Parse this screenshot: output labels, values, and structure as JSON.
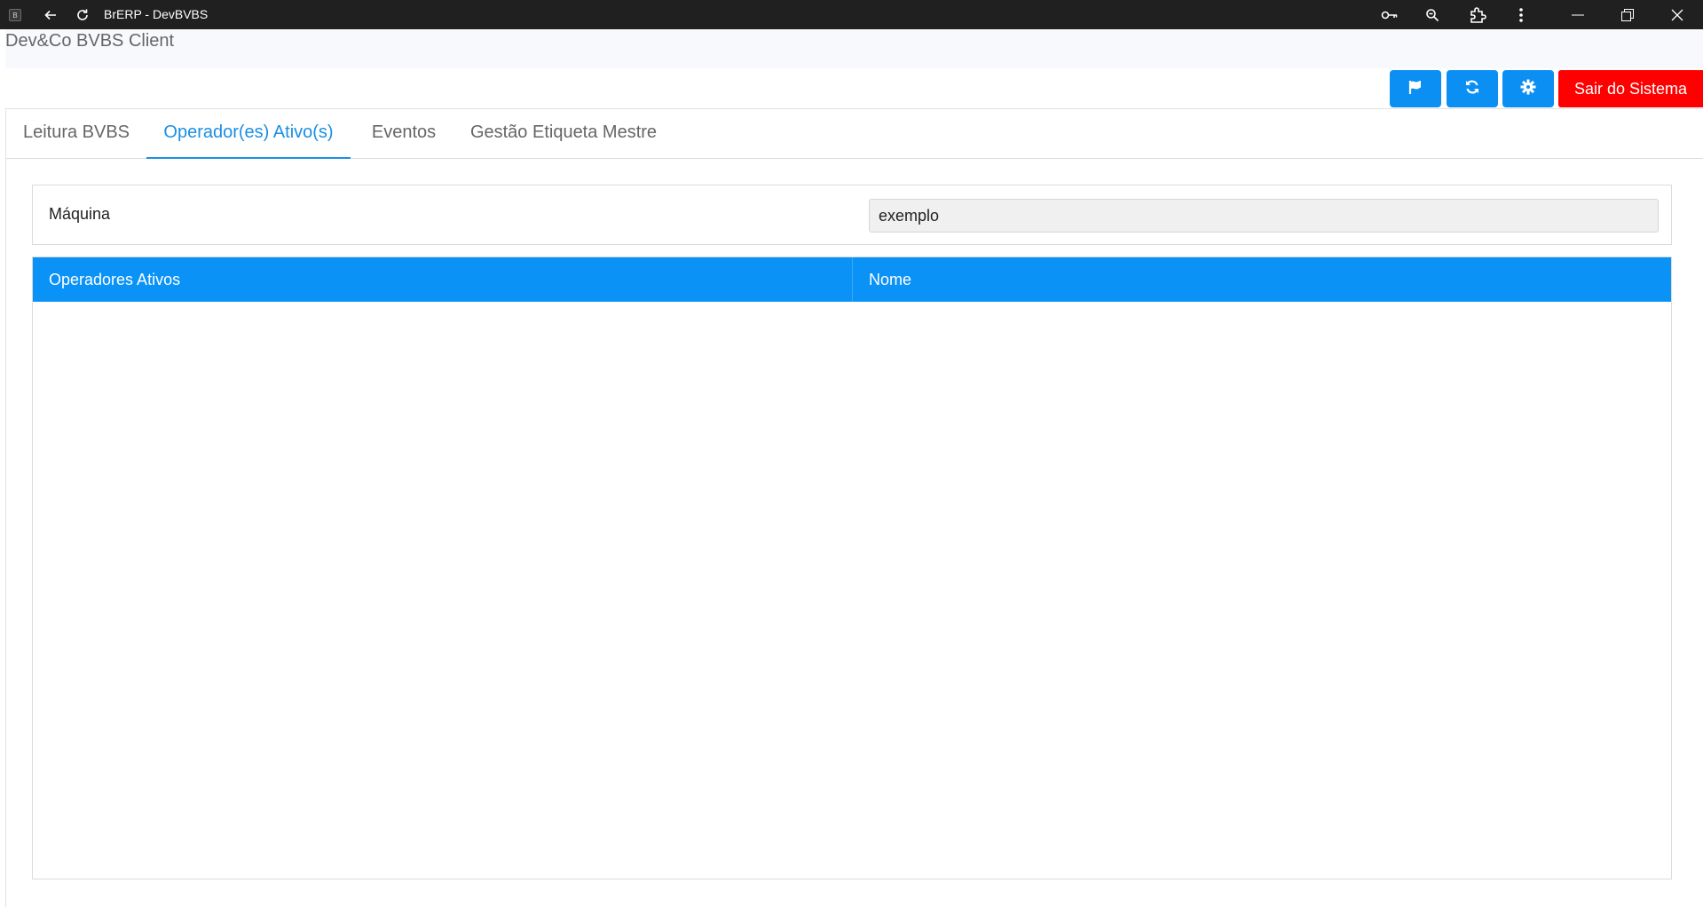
{
  "window": {
    "title": "BrERP - DevBVBS",
    "app_icon_letter": "B",
    "icons": [
      "back-arrow-icon",
      "reload-icon",
      "key-icon",
      "zoom-icon",
      "extension-icon",
      "more-vert-icon",
      "minimize-icon",
      "restore-icon",
      "close-icon"
    ]
  },
  "app": {
    "name": "Dev&Co BVBS Client"
  },
  "toolbar": {
    "buttons": [
      {
        "icon": "flag-icon",
        "color": "#0c8ff2"
      },
      {
        "icon": "refresh-icon",
        "color": "#0c8ff2"
      },
      {
        "icon": "gear-icon",
        "color": "#0c8ff2"
      }
    ],
    "exit_label": "Sair do Sistema",
    "exit_color": "#ff0000"
  },
  "tabs": [
    {
      "label": "Leitura BVBS",
      "active": false
    },
    {
      "label": "Operador(es) Ativo(s)",
      "active": true
    },
    {
      "label": "Eventos",
      "active": false
    },
    {
      "label": "Gestão Etiqueta Mestre",
      "active": false
    }
  ],
  "machine": {
    "label": "Máquina",
    "value": "exemplo"
  },
  "table": {
    "columns": [
      "Operadores Ativos",
      "Nome"
    ],
    "header_color": "#0a92f7",
    "rows": []
  }
}
